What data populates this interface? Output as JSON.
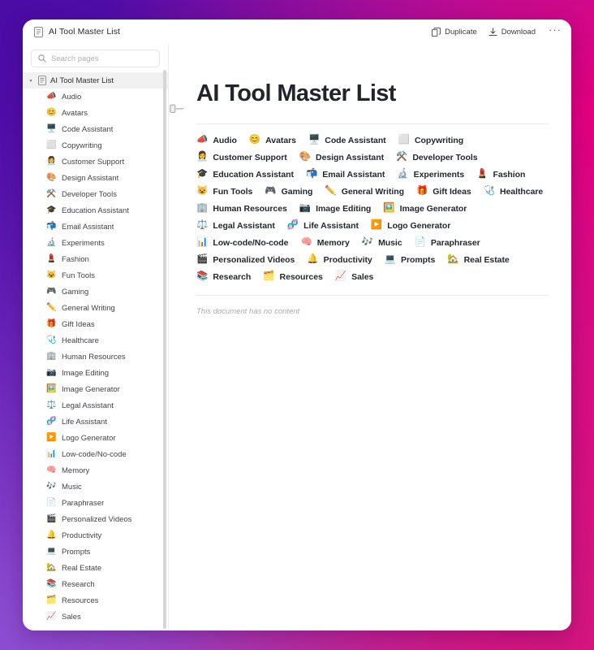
{
  "window": {
    "title": "AI Tool Master List",
    "title_icon": "document-icon"
  },
  "toolbar": {
    "duplicate_label": "Duplicate",
    "duplicate_icon": "duplicate-icon",
    "download_label": "Download",
    "download_icon": "download-icon",
    "more_label": "···"
  },
  "search": {
    "placeholder": "Search pages",
    "value": "",
    "icon": "search-icon"
  },
  "sidebar": {
    "root": {
      "label": "AI Tool Master List",
      "icon": "document-icon",
      "caret": "▾",
      "expanded": true
    },
    "items": [
      {
        "label": "Audio",
        "emoji": "📣",
        "icon": "audio-icon"
      },
      {
        "label": "Avatars",
        "emoji": "😊",
        "icon": "avatars-icon"
      },
      {
        "label": "Code Assistant",
        "emoji": "🖥️",
        "icon": "code-assistant-icon"
      },
      {
        "label": "Copywriting",
        "emoji": "⬜",
        "icon": "copywriting-icon"
      },
      {
        "label": "Customer Support",
        "emoji": "👩‍💼",
        "icon": "customer-support-icon"
      },
      {
        "label": "Design Assistant",
        "emoji": "🎨",
        "icon": "design-assistant-icon"
      },
      {
        "label": "Developer Tools",
        "emoji": "⚒️",
        "icon": "developer-tools-icon"
      },
      {
        "label": "Education Assistant",
        "emoji": "🎓",
        "icon": "education-assistant-icon"
      },
      {
        "label": "Email Assistant",
        "emoji": "📬",
        "icon": "email-assistant-icon"
      },
      {
        "label": "Experiments",
        "emoji": "🔬",
        "icon": "experiments-icon"
      },
      {
        "label": "Fashion",
        "emoji": "💄",
        "icon": "fashion-icon"
      },
      {
        "label": "Fun Tools",
        "emoji": "😺",
        "icon": "fun-tools-icon"
      },
      {
        "label": "Gaming",
        "emoji": "🎮",
        "icon": "gaming-icon"
      },
      {
        "label": "General Writing",
        "emoji": "✏️",
        "icon": "general-writing-icon"
      },
      {
        "label": "Gift Ideas",
        "emoji": "🎁",
        "icon": "gift-ideas-icon"
      },
      {
        "label": "Healthcare",
        "emoji": "🩺",
        "icon": "healthcare-icon"
      },
      {
        "label": "Human Resources",
        "emoji": "🏢",
        "icon": "human-resources-icon"
      },
      {
        "label": "Image Editing",
        "emoji": "📷",
        "icon": "image-editing-icon"
      },
      {
        "label": "Image Generator",
        "emoji": "🖼️",
        "icon": "image-generator-icon"
      },
      {
        "label": "Legal Assistant",
        "emoji": "⚖️",
        "icon": "legal-assistant-icon"
      },
      {
        "label": "Life Assistant",
        "emoji": "🧬",
        "icon": "life-assistant-icon"
      },
      {
        "label": "Logo Generator",
        "emoji": "▶️",
        "icon": "logo-generator-icon"
      },
      {
        "label": "Low-code/No-code",
        "emoji": "📊",
        "icon": "low-code-icon"
      },
      {
        "label": "Memory",
        "emoji": "🧠",
        "icon": "memory-icon"
      },
      {
        "label": "Music",
        "emoji": "🎶",
        "icon": "music-icon"
      },
      {
        "label": "Paraphraser",
        "emoji": "📄",
        "icon": "paraphraser-icon"
      },
      {
        "label": "Personalized Videos",
        "emoji": "🎬",
        "icon": "personalized-videos-icon"
      },
      {
        "label": "Productivity",
        "emoji": "🔔",
        "icon": "productivity-icon"
      },
      {
        "label": "Prompts",
        "emoji": "💻",
        "icon": "prompts-icon"
      },
      {
        "label": "Real Estate",
        "emoji": "🏡",
        "icon": "real-estate-icon"
      },
      {
        "label": "Research",
        "emoji": "📚",
        "icon": "research-icon"
      },
      {
        "label": "Resources",
        "emoji": "🗂️",
        "icon": "resources-icon"
      },
      {
        "label": "Sales",
        "emoji": "📈",
        "icon": "sales-icon"
      }
    ]
  },
  "content": {
    "title": "AI Tool Master List",
    "empty_note": "This document has no content",
    "links": [
      {
        "label": "Audio",
        "emoji": "📣"
      },
      {
        "label": "Avatars",
        "emoji": "😊"
      },
      {
        "label": "Code Assistant",
        "emoji": "🖥️"
      },
      {
        "label": "Copywriting",
        "emoji": "⬜"
      },
      {
        "label": "Customer Support",
        "emoji": "👩‍💼"
      },
      {
        "label": "Design Assistant",
        "emoji": "🎨"
      },
      {
        "label": "Developer Tools",
        "emoji": "⚒️"
      },
      {
        "label": "Education Assistant",
        "emoji": "🎓"
      },
      {
        "label": "Email Assistant",
        "emoji": "📬"
      },
      {
        "label": "Experiments",
        "emoji": "🔬"
      },
      {
        "label": "Fashion",
        "emoji": "💄"
      },
      {
        "label": "Fun Tools",
        "emoji": "😺"
      },
      {
        "label": "Gaming",
        "emoji": "🎮"
      },
      {
        "label": "General Writing",
        "emoji": "✏️"
      },
      {
        "label": "Gift Ideas",
        "emoji": "🎁"
      },
      {
        "label": "Healthcare",
        "emoji": "🩺"
      },
      {
        "label": "Human Resources",
        "emoji": "🏢"
      },
      {
        "label": "Image Editing",
        "emoji": "📷"
      },
      {
        "label": "Image Generator",
        "emoji": "🖼️"
      },
      {
        "label": "Legal Assistant",
        "emoji": "⚖️"
      },
      {
        "label": "Life Assistant",
        "emoji": "🧬"
      },
      {
        "label": "Logo Generator",
        "emoji": "▶️"
      },
      {
        "label": "Low-code/No-code",
        "emoji": "📊"
      },
      {
        "label": "Memory",
        "emoji": "🧠"
      },
      {
        "label": "Music",
        "emoji": "🎶"
      },
      {
        "label": "Paraphraser",
        "emoji": "📄"
      },
      {
        "label": "Personalized Videos",
        "emoji": "🎬"
      },
      {
        "label": "Productivity",
        "emoji": "🔔"
      },
      {
        "label": "Prompts",
        "emoji": "💻"
      },
      {
        "label": "Real Estate",
        "emoji": "🏡"
      },
      {
        "label": "Research",
        "emoji": "📚"
      },
      {
        "label": "Resources",
        "emoji": "🗂️"
      },
      {
        "label": "Sales",
        "emoji": "📈"
      }
    ]
  },
  "colors": {
    "background_start": "#5b11b0",
    "background_end": "#e0107c",
    "window": "#ffffff",
    "text": "#212529",
    "muted": "#a9adb2"
  }
}
